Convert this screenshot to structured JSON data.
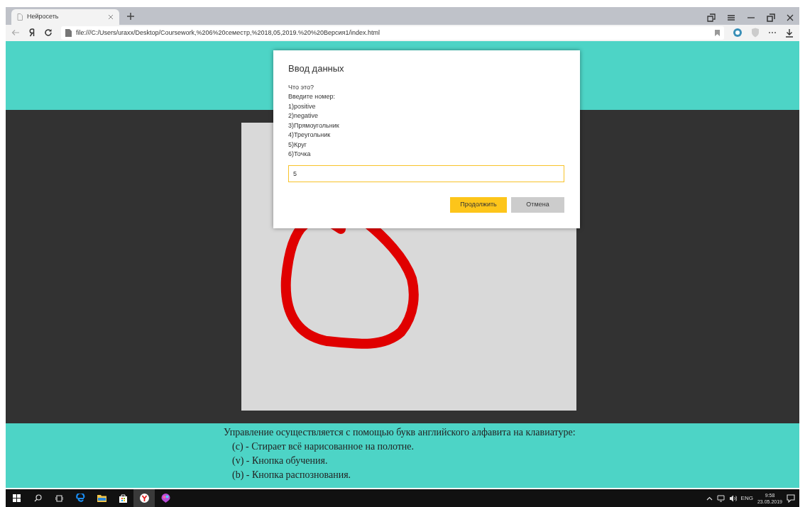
{
  "browser": {
    "tabs": [
      {
        "title": "Нейросеть",
        "selected": true
      }
    ],
    "address": "file:///C:/Users/uraxx/Desktop/Coursework,%206%20семестр,%2018,05,2019.%20%20Версия1/index.html"
  },
  "instructions": {
    "heading": "Управление осуществляется с помощью букв английского алфавита на клавиатуре:",
    "keys": [
      "(c) - Стирает всё нарисованное на полотне.",
      "(v) - Кнопка обучения.",
      "(b) - Кнопка распознования."
    ]
  },
  "dialog": {
    "title": "Ввод данных",
    "lines": [
      "Что это?",
      "Введите номер:",
      "1)positive",
      "2)negative",
      "3)Прямоугольник",
      "4)Треугольник",
      "5)Круг",
      "6)Точка"
    ],
    "input_value": "5",
    "buttons": [
      {
        "label": "Продолжить",
        "kind": "primary"
      },
      {
        "label": "Отмена",
        "kind": "secondary"
      }
    ]
  },
  "taskbar": {
    "apps": [
      {
        "kind": "edge",
        "selected": false
      },
      {
        "kind": "folder",
        "selected": false
      },
      {
        "kind": "store",
        "selected": false
      },
      {
        "kind": "yandex",
        "selected": true
      },
      {
        "kind": "paint",
        "selected": false
      }
    ],
    "language": "ENG",
    "time": "9:58",
    "date": "23.05.2019"
  }
}
